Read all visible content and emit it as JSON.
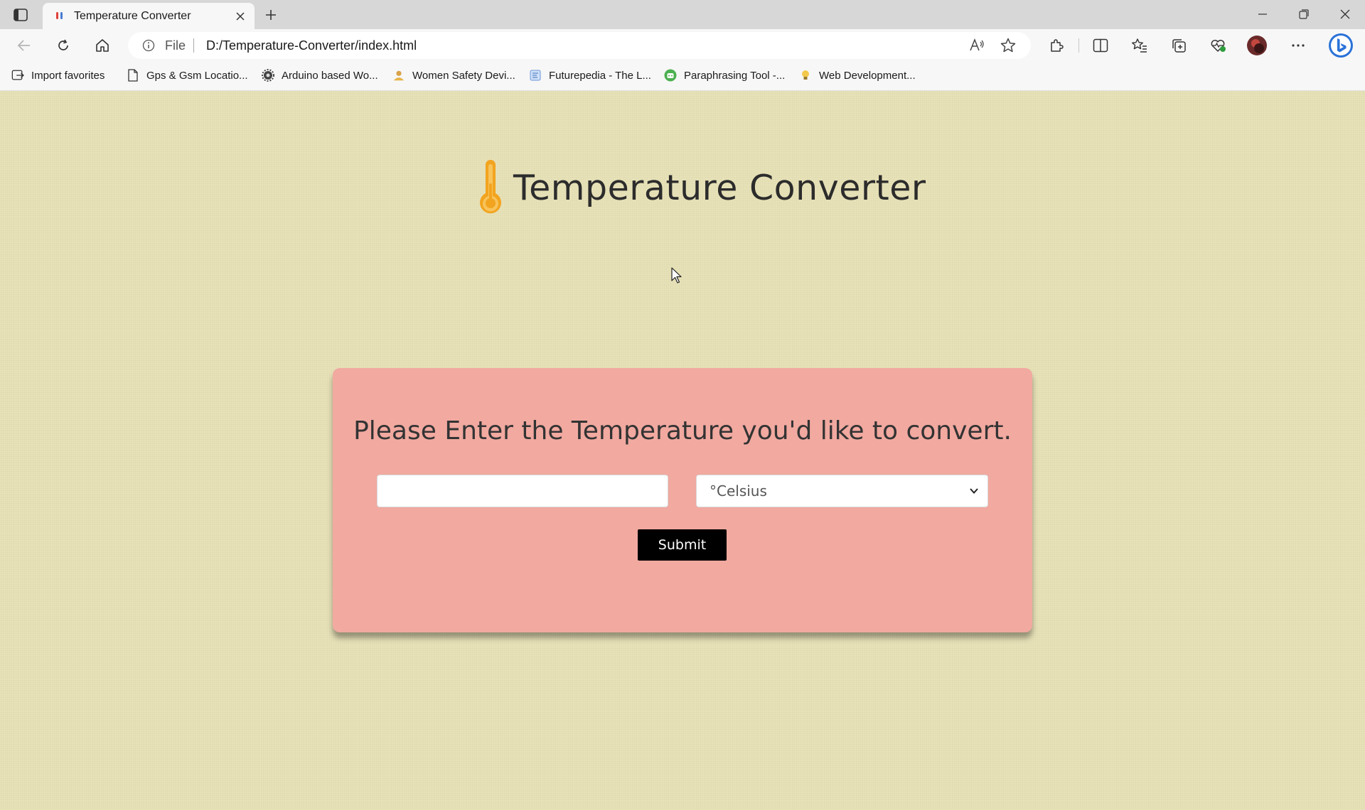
{
  "browser": {
    "tab": {
      "title": "Temperature Converter"
    },
    "address": {
      "scheme_label": "File",
      "url": "D:/Temperature-Converter/index.html"
    },
    "bookmarks": [
      {
        "label": "Import favorites",
        "icon": "import-icon"
      },
      {
        "label": "Gps & Gsm Locatio...",
        "icon": "page-icon"
      },
      {
        "label": "Arduino based Wo...",
        "icon": "gear-icon"
      },
      {
        "label": "Women Safety Devi...",
        "icon": "person-icon"
      },
      {
        "label": "Futurepedia - The L...",
        "icon": "site-icon"
      },
      {
        "label": "Paraphrasing Tool -...",
        "icon": "robot-icon"
      },
      {
        "label": "Web Development...",
        "icon": "bulb-icon"
      }
    ]
  },
  "page": {
    "title": "Temperature Converter",
    "prompt": "Please Enter the Temperature you'd like to convert.",
    "temperature_input": {
      "value": "",
      "placeholder": ""
    },
    "unit_select": {
      "selected": "°Celsius"
    },
    "submit_label": "Submit",
    "colors": {
      "background": "#e8e2b8",
      "card": "#f1a9a0",
      "button": "#000000",
      "thermometer": "#f2a41f"
    }
  }
}
